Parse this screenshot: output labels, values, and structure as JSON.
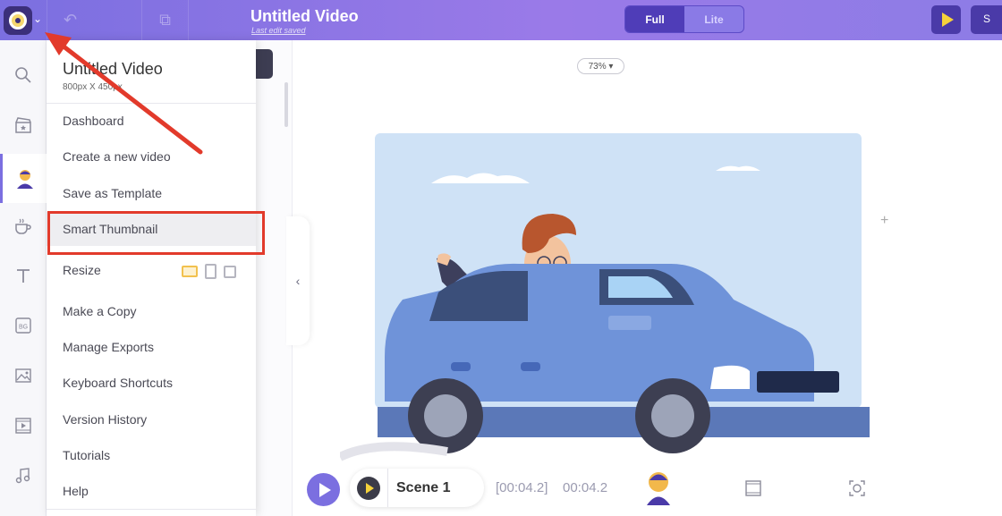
{
  "header": {
    "title": "Untitled Video",
    "subtitle": "Last edit saved",
    "mode_full": "Full",
    "mode_lite": "Lite",
    "save_label": "S"
  },
  "menu": {
    "title": "Untitled Video",
    "dimensions": "800px X 450px",
    "items": [
      "Dashboard",
      "Create a new video",
      "Save as Template",
      "Smart Thumbnail",
      "Resize",
      "Make a Copy",
      "Manage Exports",
      "Keyboard Shortcuts",
      "Version History",
      "Tutorials",
      "Help"
    ],
    "highlighted": "Smart Thumbnail"
  },
  "canvas": {
    "zoom": "73%"
  },
  "timeline": {
    "scene_label": "Scene 1",
    "time_bracket": "[00:04.2]",
    "time_total": "00:04.2"
  },
  "colors": {
    "brand": "#7b6fe0",
    "annotation": "#e23a2b",
    "accent_yellow": "#f5d23b"
  },
  "icons": [
    "search-icon",
    "clapperboard-icon",
    "character-icon",
    "coffee-cup-icon",
    "text-icon",
    "background-icon",
    "image-icon",
    "video-icon",
    "music-icon"
  ]
}
